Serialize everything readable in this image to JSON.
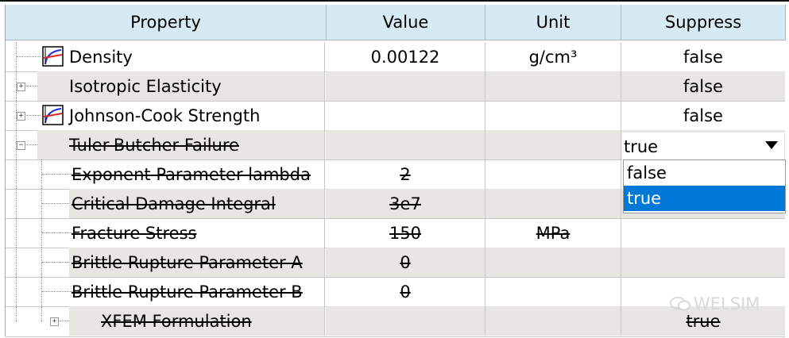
{
  "header": {
    "columns": [
      "Property",
      "Value",
      "Unit",
      "Suppress"
    ]
  },
  "rows": [
    {
      "name": "Density",
      "value": "0.00122",
      "unit": "g/cm³",
      "suppress": "false"
    },
    {
      "name": "Isotropic Elasticity",
      "value": "",
      "unit": "",
      "suppress": "false"
    },
    {
      "name": "Johnson-Cook Strength",
      "value": "",
      "unit": "",
      "suppress": "false"
    },
    {
      "name": "Tuler-Butcher Failure",
      "value": "",
      "unit": "",
      "suppress": "true"
    },
    {
      "name": "Exponent Parameter lambda",
      "value": "2",
      "unit": "",
      "suppress": ""
    },
    {
      "name": "Critical Damage Integral",
      "value": "3e7",
      "unit": "",
      "suppress": ""
    },
    {
      "name": "Fracture Stress",
      "value": "150",
      "unit": "MPa",
      "suppress": ""
    },
    {
      "name": "Brittle Rupture Parameter A",
      "value": "0",
      "unit": "",
      "suppress": ""
    },
    {
      "name": "Brittle Rupture Parameter B",
      "value": "0",
      "unit": "",
      "suppress": ""
    },
    {
      "name": "XFEM Formulation",
      "value": "",
      "unit": "",
      "suppress": "true"
    }
  ],
  "dropdown": {
    "current": "true",
    "options": [
      "false",
      "true"
    ],
    "selected_index": 1
  },
  "watermark": "WELSIM"
}
